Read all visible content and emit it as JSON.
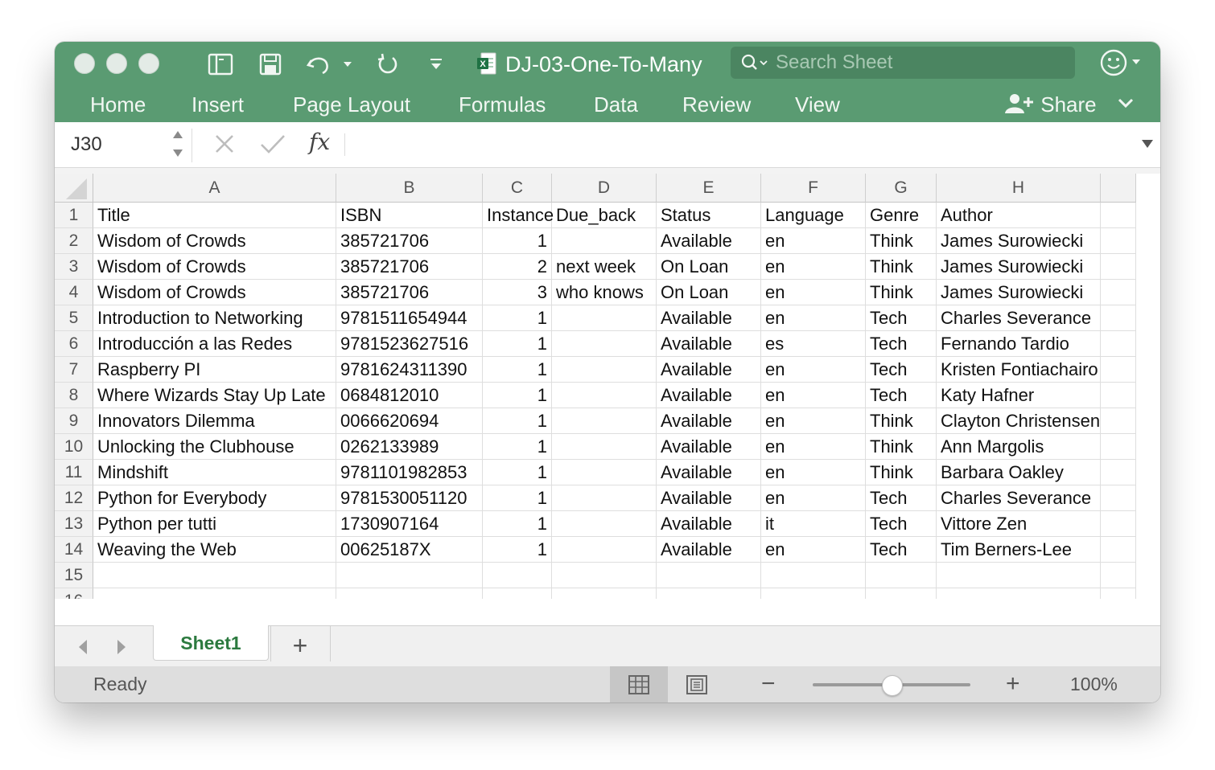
{
  "window": {
    "title": "DJ-03-One-To-Many",
    "search_placeholder": "Search Sheet"
  },
  "ribbon": {
    "tabs": [
      "Home",
      "Insert",
      "Page Layout",
      "Formulas",
      "Data",
      "Review",
      "View"
    ],
    "share_label": "Share"
  },
  "formula_bar": {
    "cell_reference": "J30",
    "fx_label": "fx",
    "content": ""
  },
  "sheet": {
    "columns": [
      "A",
      "B",
      "C",
      "D",
      "E",
      "F",
      "G",
      "H"
    ],
    "row_numbers": [
      "1",
      "2",
      "3",
      "4",
      "5",
      "6",
      "7",
      "8",
      "9",
      "10",
      "11",
      "12",
      "13",
      "14",
      "15",
      "16"
    ],
    "rows": [
      [
        "Title",
        "ISBN",
        "Instance",
        "Due_back",
        "Status",
        "Language",
        "Genre",
        "Author"
      ],
      [
        "Wisdom of Crowds",
        "385721706",
        "1",
        "",
        "Available",
        "en",
        "Think",
        "James Surowiecki"
      ],
      [
        "Wisdom of Crowds",
        "385721706",
        "2",
        "next week",
        "On Loan",
        "en",
        "Think",
        "James Surowiecki"
      ],
      [
        "Wisdom of Crowds",
        "385721706",
        "3",
        "who knows",
        "On Loan",
        "en",
        "Think",
        "James Surowiecki"
      ],
      [
        "Introduction to Networking",
        "9781511654944",
        "1",
        "",
        "Available",
        "en",
        "Tech",
        "Charles Severance"
      ],
      [
        "Introducción a las Redes",
        "9781523627516",
        "1",
        "",
        "Available",
        "es",
        "Tech",
        "Fernando Tardio"
      ],
      [
        "Raspberry PI",
        "9781624311390",
        "1",
        "",
        "Available",
        "en",
        "Tech",
        "Kristen Fontiachairo"
      ],
      [
        "Where Wizards Stay Up Late",
        "0684812010",
        "1",
        "",
        "Available",
        "en",
        "Tech",
        "Katy Hafner"
      ],
      [
        "Innovators Dilemma",
        "0066620694",
        "1",
        "",
        "Available",
        "en",
        "Think",
        "Clayton Christensen"
      ],
      [
        "Unlocking the Clubhouse",
        "0262133989",
        "1",
        "",
        "Available",
        "en",
        "Think",
        "Ann Margolis"
      ],
      [
        "Mindshift",
        "9781101982853",
        "1",
        "",
        "Available",
        "en",
        "Think",
        "Barbara Oakley"
      ],
      [
        "Python for Everybody",
        "9781530051120",
        "1",
        "",
        "Available",
        "en",
        "Tech",
        "Charles Severance"
      ],
      [
        "Python per tutti",
        "1730907164",
        "1",
        "",
        "Available",
        "it",
        "Tech",
        "Vittore Zen"
      ],
      [
        "Weaving the Web",
        "00625187X",
        "1",
        "",
        "Available",
        "en",
        "Tech",
        "Tim Berners-Lee"
      ],
      [
        "",
        "",
        "",
        "",
        "",
        "",
        "",
        ""
      ],
      [
        "",
        "",
        "",
        "",
        "",
        "",
        "",
        ""
      ]
    ]
  },
  "sheet_tabs": {
    "active": "Sheet1",
    "add_label": "+"
  },
  "status_bar": {
    "status": "Ready",
    "zoom_label": "100%",
    "zoom_fraction": 0.5
  },
  "colors": {
    "ribbon": "#5a9b72",
    "search": "#4b8561",
    "active_tab_text": "#2c7a3f"
  }
}
